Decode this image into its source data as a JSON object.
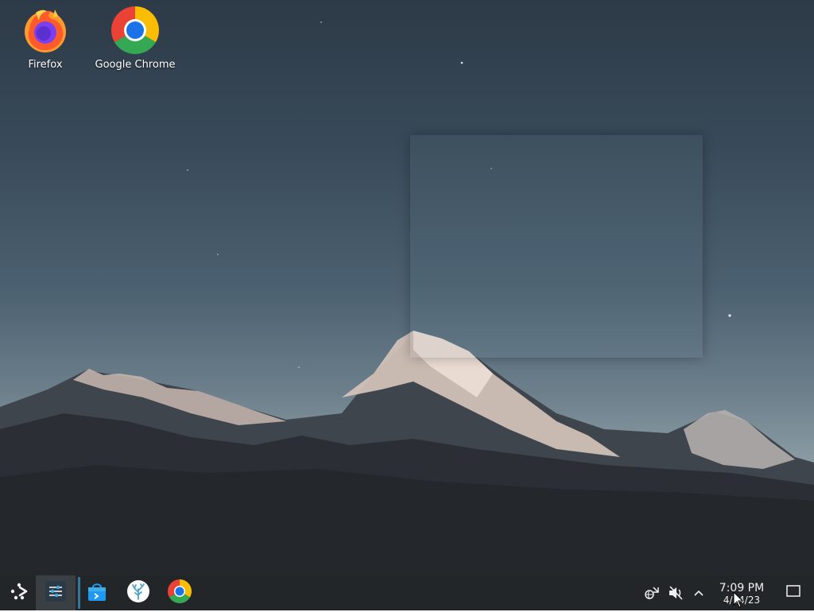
{
  "desktop": {
    "icons": [
      {
        "label": "Firefox",
        "icon": "firefox-icon"
      },
      {
        "label": "Google Chrome",
        "icon": "chrome-icon"
      }
    ],
    "wallpaper": "mountain-dusk"
  },
  "taskbar": {
    "launcher_icon": "application-launcher-icon",
    "pinned": [
      {
        "name": "system-settings",
        "icon": "sliders-icon",
        "active": true
      },
      {
        "name": "discover-store",
        "icon": "shopping-bag-icon",
        "active": false
      },
      {
        "name": "flatpak-app",
        "icon": "coral-icon",
        "active": false
      },
      {
        "name": "google-chrome",
        "icon": "chrome-icon",
        "active": false
      }
    ],
    "tray": {
      "icons": [
        "network-icon",
        "volume-muted-icon",
        "chevron-up-icon"
      ],
      "clock": {
        "time": "7:09 PM",
        "date": "4/14/23"
      },
      "show_desktop_icon": "show-desktop-icon"
    }
  },
  "colors": {
    "taskbar_bg": "#232629",
    "taskbar_active": "#3a3f44",
    "accent": "#3daee9"
  }
}
